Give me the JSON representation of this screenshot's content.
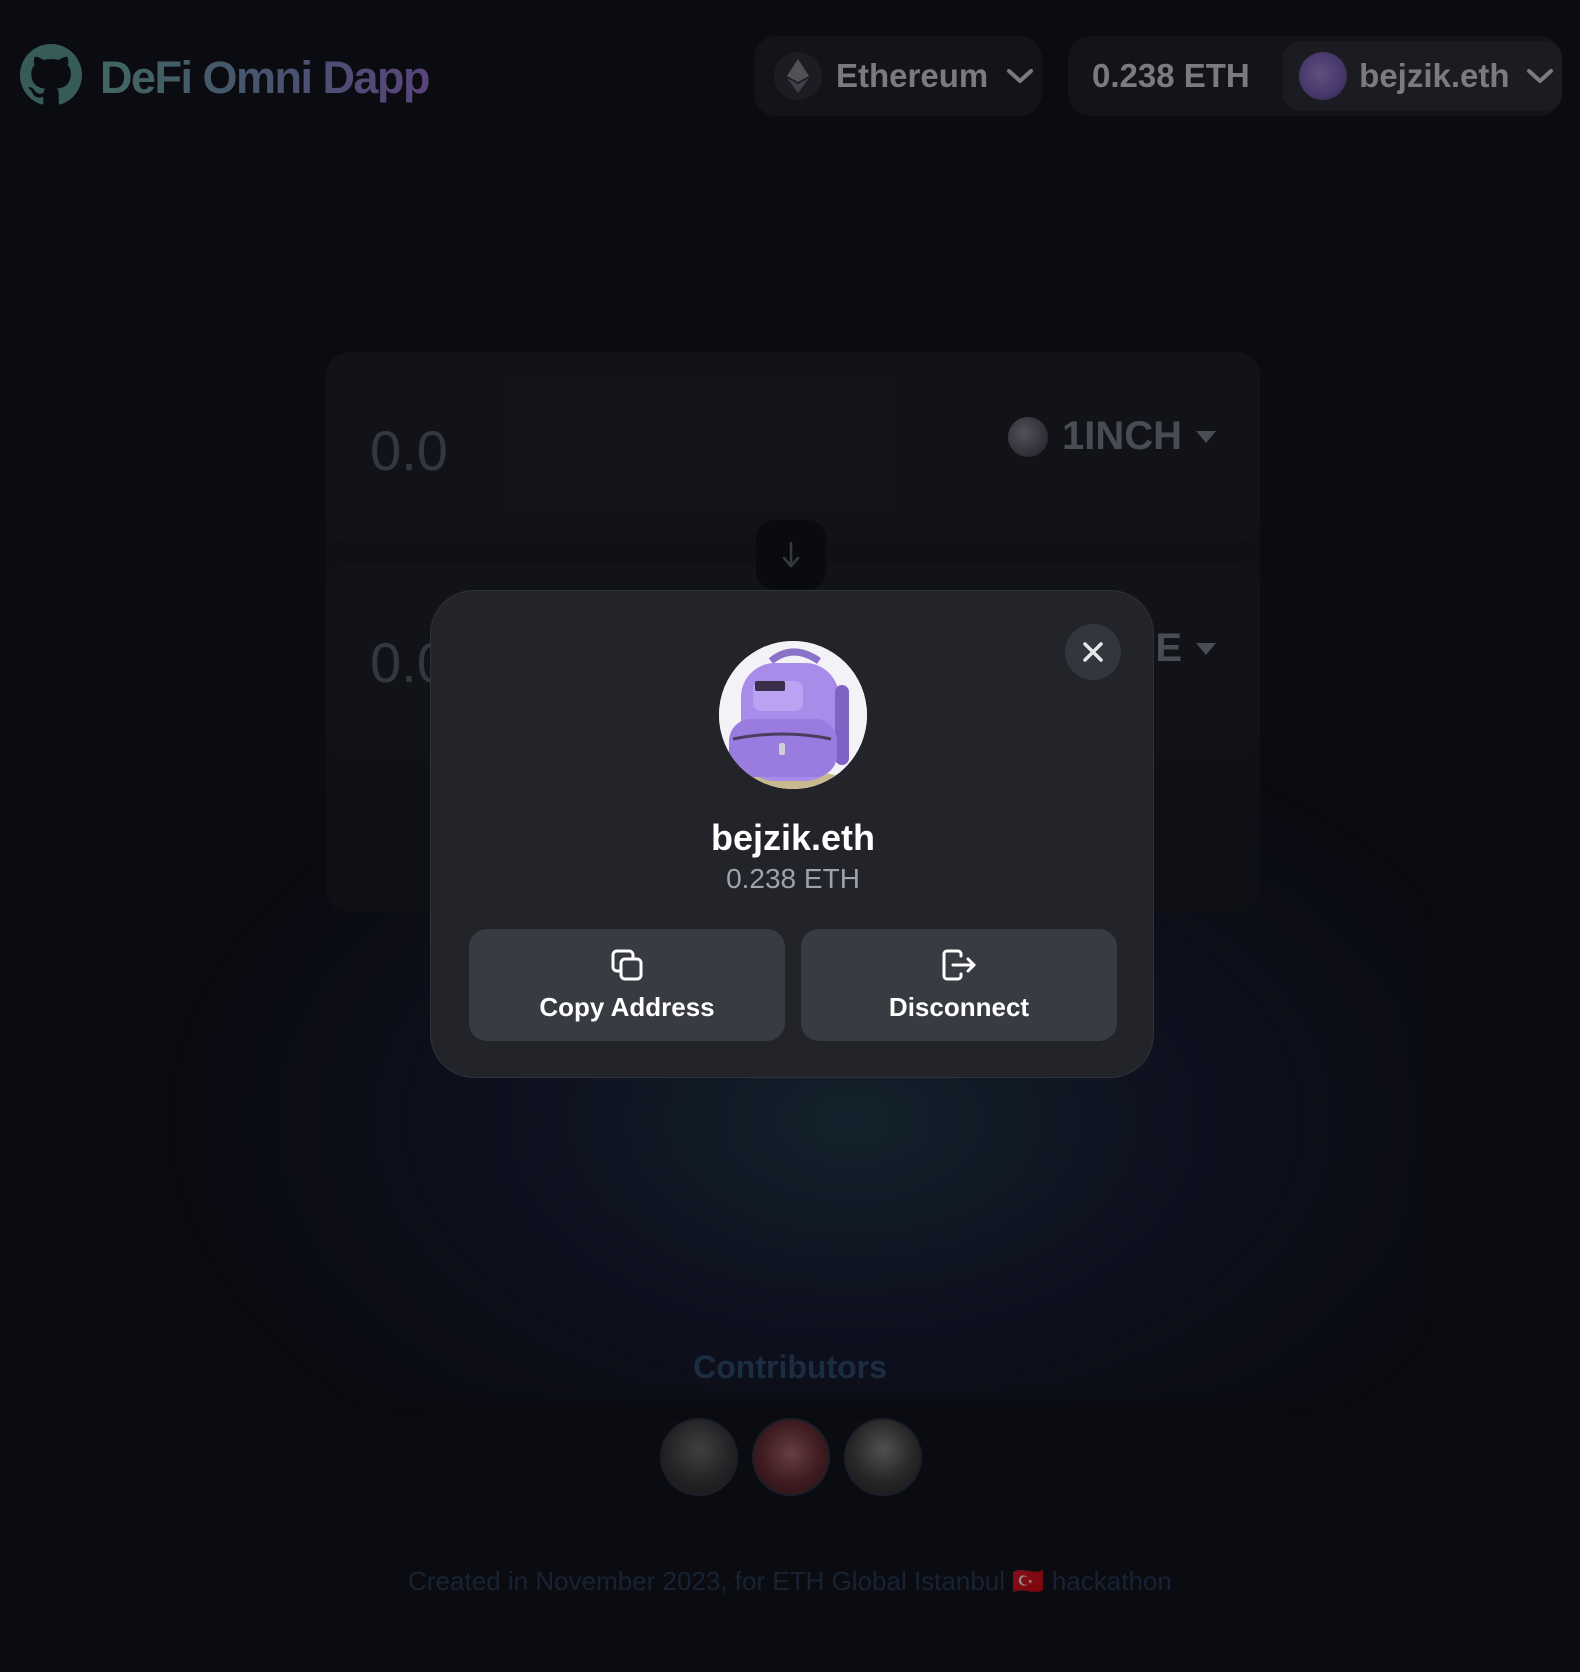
{
  "header": {
    "brand_title": "DeFi Omni Dapp",
    "network_label": "Ethereum",
    "balance": "0.238 ETH",
    "account_name": "bejzik.eth"
  },
  "swap": {
    "from_amount": "0.0",
    "from_token": "1INCH",
    "to_amount": "0.0",
    "to_token_partial": "E"
  },
  "contributors": {
    "title": "Contributors",
    "avatars": [
      "contributor-1",
      "contributor-2",
      "contributor-3"
    ]
  },
  "footer": {
    "text": "Created in November 2023, for ETH Global Istanbul 🇹🇷 hackathon"
  },
  "modal": {
    "name": "bejzik.eth",
    "balance": "0.238 ETH",
    "copy_label": "Copy Address",
    "disconnect_label": "Disconnect",
    "avatar_icon": "backpack-avatar"
  },
  "colors": {
    "brand_gradient_start": "#6fb3a8",
    "brand_gradient_end": "#9b76d6",
    "modal_bg": "#232429",
    "action_bg": "#393b43"
  }
}
